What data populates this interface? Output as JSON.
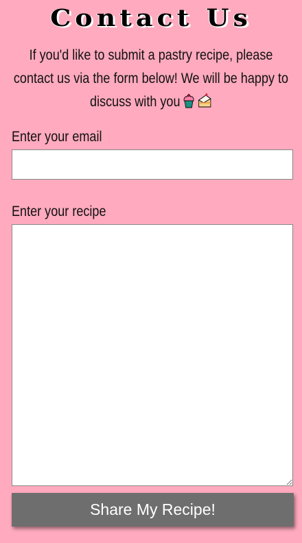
{
  "page": {
    "title": "Contact Us",
    "intro": "If you'd like to submit a pastry recipe, please contact us via the form below! We will be happy to discuss with you",
    "intro_icons": [
      "cupcake-icon",
      "cake-slice-icon"
    ]
  },
  "form": {
    "email_label": "Enter your email",
    "email_value": "",
    "email_placeholder": "",
    "recipe_label": "Enter your recipe",
    "recipe_value": "",
    "recipe_placeholder": "",
    "submit_label": "Share My Recipe!"
  },
  "colors": {
    "background": "#ffaabe",
    "button": "#6e6e6e",
    "button_text": "#ffffff"
  }
}
